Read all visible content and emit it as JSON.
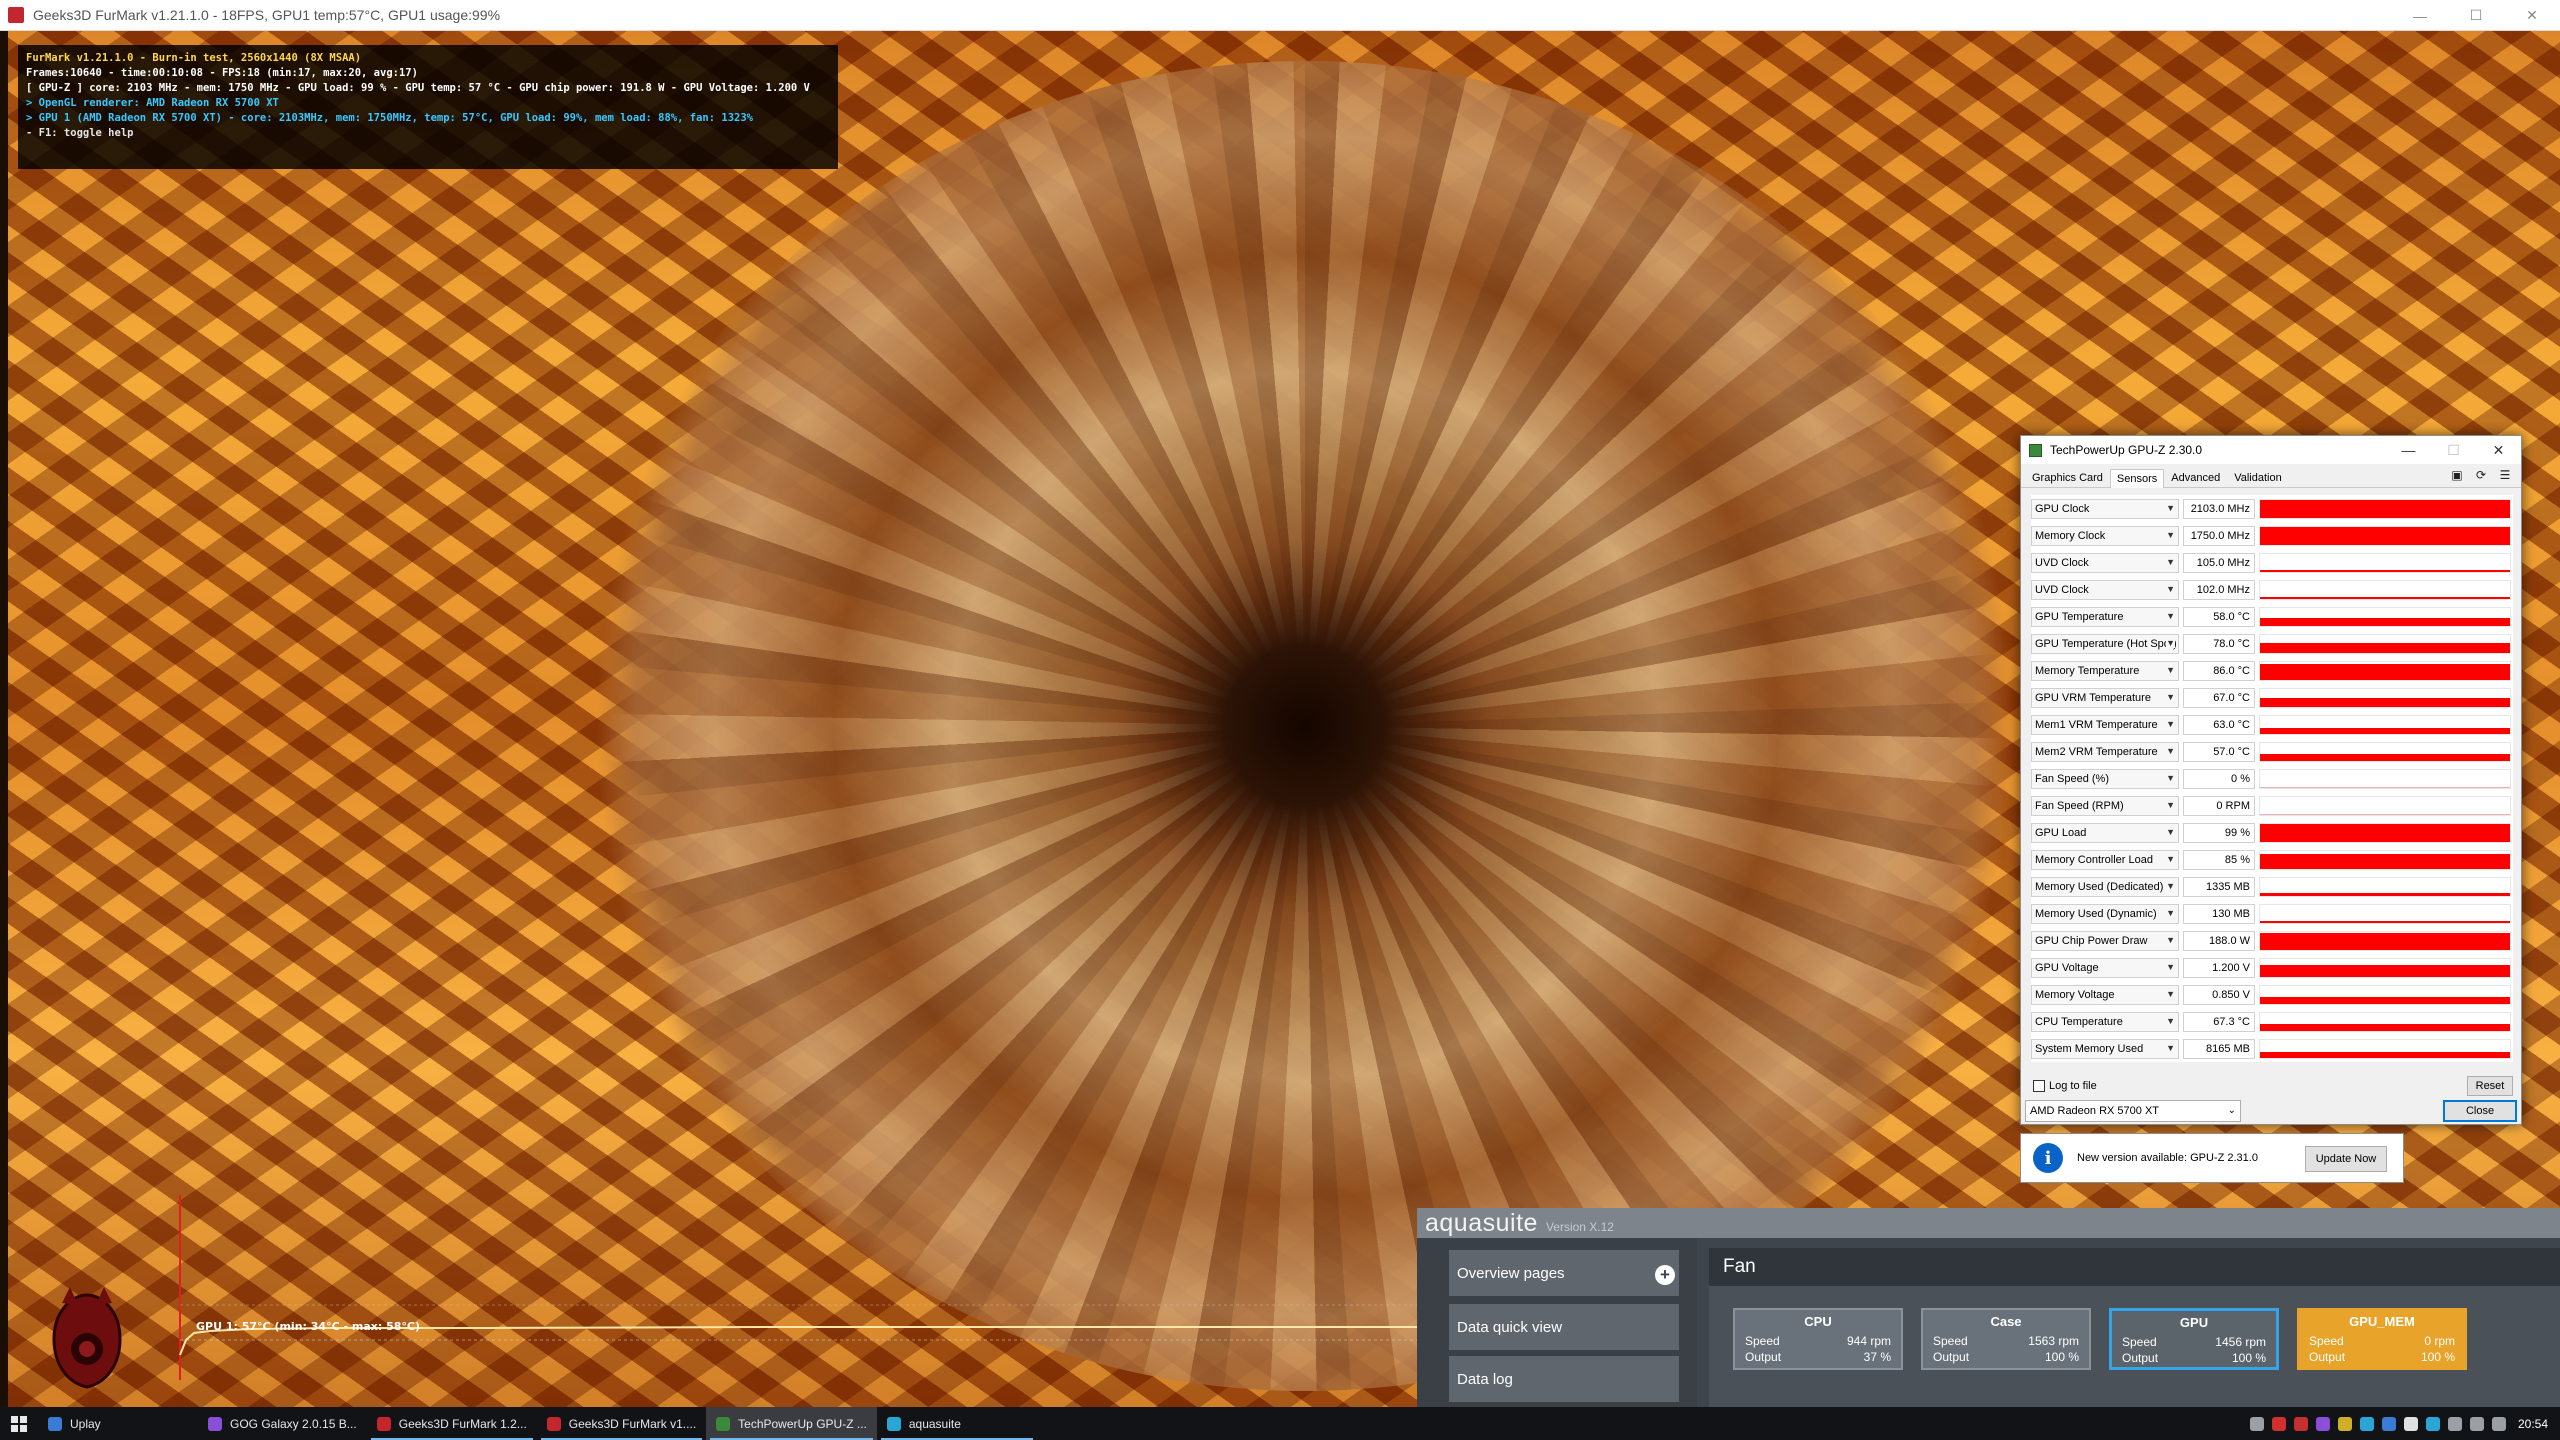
{
  "furmark": {
    "window_title": "Geeks3D FurMark v1.21.1.0 - 18FPS, GPU1 temp:57°C, GPU1 usage:99%",
    "osd": [
      "FurMark v1.21.1.0 - Burn-in test, 2560x1440 (8X MSAA)",
      "Frames:10640 - time:00:10:08 - FPS:18 (min:17, max:20, avg:17)",
      "[ GPU-Z ] core: 2103 MHz - mem: 1750 MHz - GPU load: 99 % - GPU temp: 57 °C - GPU chip power: 191.8 W - GPU Voltage: 1.200 V",
      "> OpenGL renderer: AMD Radeon RX 5700 XT",
      "> GPU 1 (AMD Radeon RX 5700 XT) - core: 2103MHz, mem: 1750MHz, temp: 57°C, GPU load: 99%, mem load: 88%, fan: 1323%",
      "- F1: toggle help"
    ],
    "temp_graph_label": "GPU 1: 57°C (min: 34°C - max: 58°C)",
    "temp_graph": {
      "min": 34,
      "max": 58,
      "current": 57
    }
  },
  "gpuz": {
    "title": "TechPowerUp GPU-Z 2.30.0",
    "tabs": [
      "Graphics Card",
      "Sensors",
      "Advanced",
      "Validation"
    ],
    "active_tab": "Sensors",
    "sensors": [
      {
        "name": "GPU Clock",
        "value": "2103.0 MHz",
        "level": 0.95
      },
      {
        "name": "Memory Clock",
        "value": "1750.0 MHz",
        "level": 0.95
      },
      {
        "name": "UVD Clock",
        "value": "105.0 MHz",
        "level": 0.06
      },
      {
        "name": "UVD Clock",
        "value": "102.0 MHz",
        "level": 0.06
      },
      {
        "name": "GPU Temperature",
        "value": "58.0 °C",
        "level": 0.4
      },
      {
        "name": "GPU Temperature (Hot Spot)",
        "value": "78.0 °C",
        "level": 0.55
      },
      {
        "name": "Memory Temperature",
        "value": "86.0 °C",
        "level": 0.85
      },
      {
        "name": "GPU VRM Temperature",
        "value": "67.0 °C",
        "level": 0.45
      },
      {
        "name": "Mem1 VRM Temperature",
        "value": "63.0 °C",
        "level": 0.3
      },
      {
        "name": "Mem2 VRM Temperature",
        "value": "57.0 °C",
        "level": 0.35
      },
      {
        "name": "Fan Speed (%)",
        "value": "0 %",
        "level": 0
      },
      {
        "name": "Fan Speed (RPM)",
        "value": "0 RPM",
        "level": 0
      },
      {
        "name": "GPU Load",
        "value": "99 %",
        "level": 0.95
      },
      {
        "name": "Memory Controller Load",
        "value": "85 %",
        "level": 0.8
      },
      {
        "name": "Memory Used (Dedicated)",
        "value": "1335 MB",
        "level": 0.15
      },
      {
        "name": "Memory Used (Dynamic)",
        "value": "130 MB",
        "level": 0.04
      },
      {
        "name": "GPU Chip Power Draw",
        "value": "188.0 W",
        "level": 0.9
      },
      {
        "name": "GPU Voltage",
        "value": "1.200 V",
        "level": 0.65
      },
      {
        "name": "Memory Voltage",
        "value": "0.850 V",
        "level": 0.35
      },
      {
        "name": "CPU Temperature",
        "value": "67.3 °C",
        "level": 0.35
      },
      {
        "name": "System Memory Used",
        "value": "8165 MB",
        "level": 0.3
      }
    ],
    "log_to_file": "Log to file",
    "reset": "Reset",
    "card": "AMD Radeon RX 5700 XT",
    "close": "Close",
    "update_message": "New version available: GPU-Z 2.31.0",
    "update_button": "Update Now",
    "graph_color": "#ff0000"
  },
  "aquasuite": {
    "brand": "aquasuite",
    "version": "Version X.12",
    "nav": [
      "Overview pages",
      "Data quick view",
      "Data log"
    ],
    "section_title": "Fan",
    "fans": [
      {
        "name": "CPU",
        "speed_label": "Speed",
        "speed": "944 rpm",
        "output_label": "Output",
        "output": "37 %",
        "state": "normal"
      },
      {
        "name": "Case",
        "speed_label": "Speed",
        "speed": "1563 rpm",
        "output_label": "Output",
        "output": "100 %",
        "state": "normal"
      },
      {
        "name": "GPU",
        "speed_label": "Speed",
        "speed": "1456 rpm",
        "output_label": "Output",
        "output": "100 %",
        "state": "selected"
      },
      {
        "name": "GPU_MEM",
        "speed_label": "Speed",
        "speed": "0 rpm",
        "output_label": "Output",
        "output": "100 %",
        "state": "warning"
      }
    ]
  },
  "taskbar": {
    "items": [
      {
        "label": "Uplay",
        "icon_color": "#3a7bd5",
        "state": "normal"
      },
      {
        "label": "GOG Galaxy 2.0.15 B...",
        "icon_color": "#8a4fd8",
        "state": "normal"
      },
      {
        "label": "Geeks3D FurMark 1.2...",
        "icon_color": "#c1272d",
        "state": "running"
      },
      {
        "label": "Geeks3D FurMark v1....",
        "icon_color": "#c1272d",
        "state": "running"
      },
      {
        "label": "TechPowerUp GPU-Z ...",
        "icon_color": "#3b8a3b",
        "state": "active"
      },
      {
        "label": "aquasuite",
        "icon_color": "#2aa6d6",
        "state": "running"
      }
    ],
    "clock": "20:54",
    "tray_icons": [
      "#9aa0a6",
      "#d03030",
      "#c23030",
      "#8a4fd8",
      "#cfae2a",
      "#2aa6d6",
      "#3a7bd5",
      "#e0e0e0",
      "#2aa6d6",
      "#9aa0a6",
      "#9aa0a6",
      "#9aa0a6"
    ]
  }
}
